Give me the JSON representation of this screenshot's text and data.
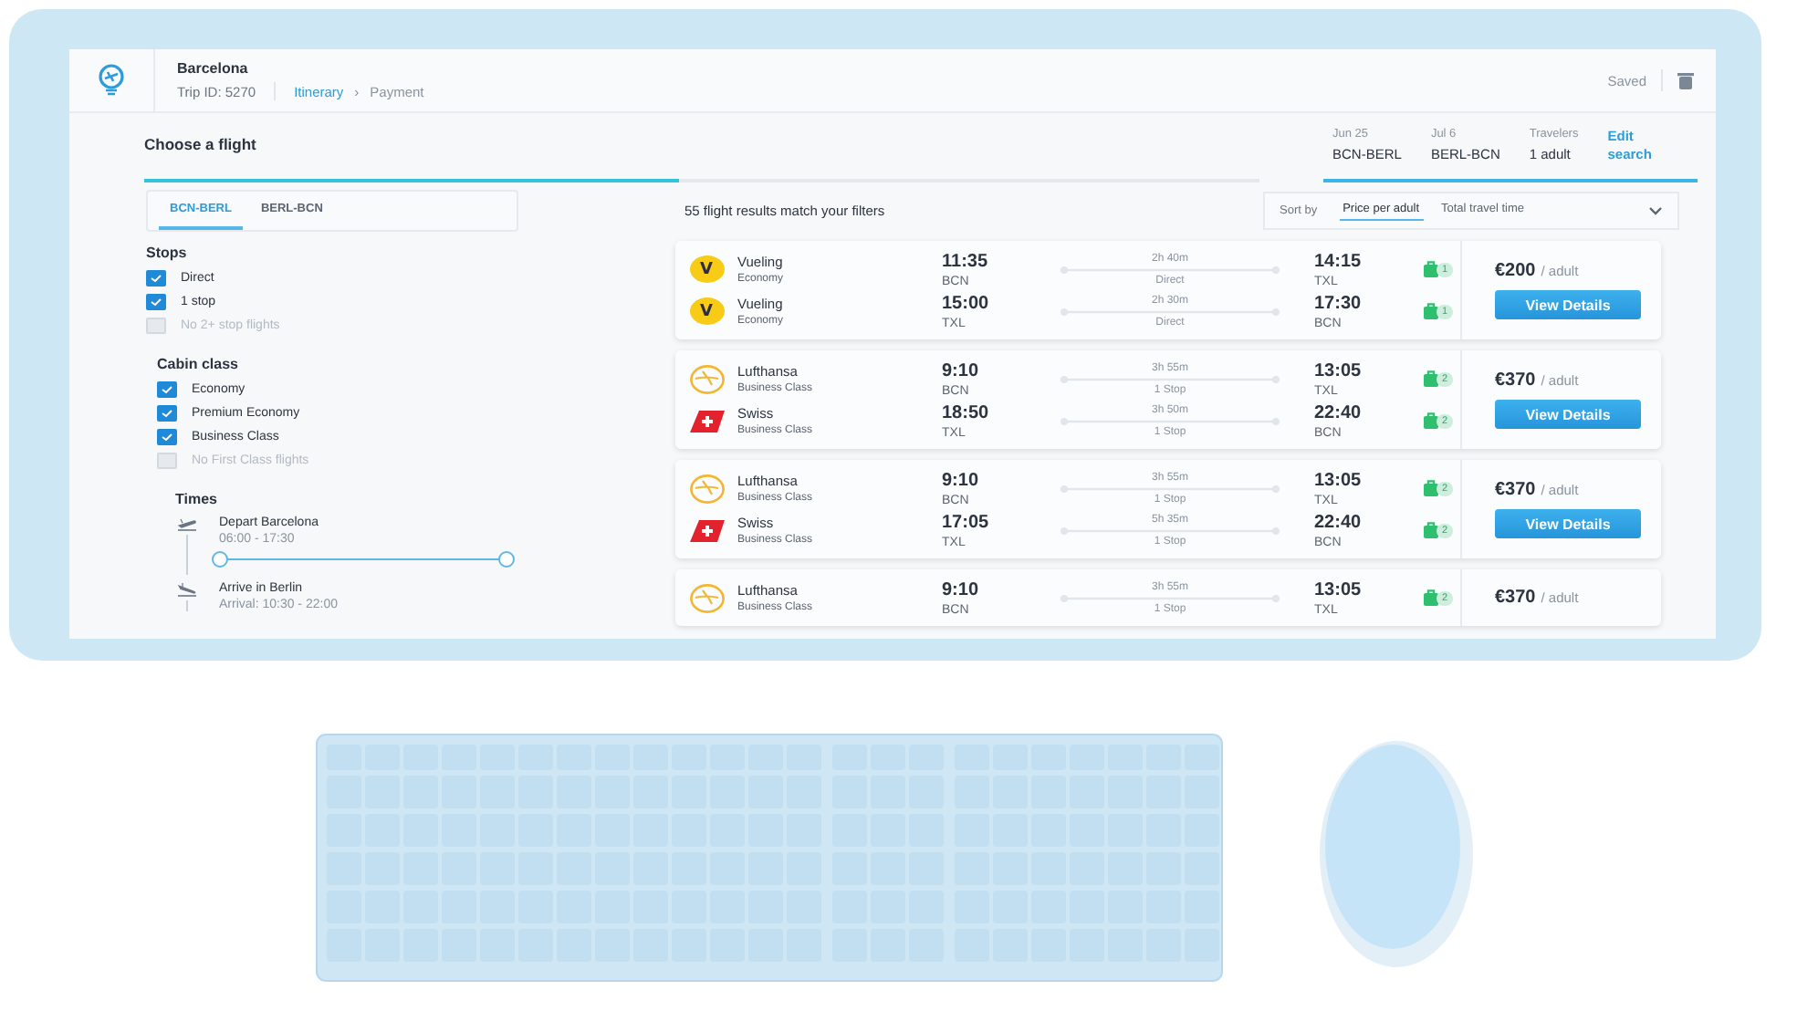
{
  "header": {
    "city": "Barcelona",
    "trip_id": "Trip ID: 5270",
    "breadcrumb": [
      {
        "label": "Itinerary",
        "selected": true
      },
      {
        "label": "Payment",
        "selected": false
      }
    ],
    "separator": "›",
    "saved": "Saved"
  },
  "page_title": "Choose a flight",
  "step_progress": {
    "level": 0.48
  },
  "trip_summary": [
    {
      "label": "Jun 25",
      "value": "BCN-BERL"
    },
    {
      "label": "Jul 6",
      "value": "BERL-BCN"
    },
    {
      "label": "Travelers",
      "value": "1 adult"
    }
  ],
  "edit_link": "Edit search",
  "route_tabs": [
    {
      "label": "BCN-BERL",
      "selected": true
    },
    {
      "label": "BERL-BCN",
      "selected": false
    }
  ],
  "results_count": "55 flight results match your filters",
  "sort": {
    "label": "Sort by",
    "options": [
      {
        "label": "Price per adult",
        "selected": true
      },
      {
        "label": "Total travel time",
        "selected": false
      }
    ]
  },
  "filters": [
    {
      "title": "Stops",
      "options": [
        {
          "label": "Direct",
          "checked": true,
          "disabled": false
        },
        {
          "label": "1 stop",
          "checked": true,
          "disabled": false
        },
        {
          "label": "No 2+ stop flights",
          "checked": false,
          "disabled": true
        }
      ]
    },
    {
      "title": "Cabin class",
      "options": [
        {
          "label": "Economy",
          "checked": true,
          "disabled": false
        },
        {
          "label": "Premium Economy",
          "checked": true,
          "disabled": false
        },
        {
          "label": "Business Class",
          "checked": true,
          "disabled": false
        },
        {
          "label": "No First Class flights",
          "checked": false,
          "disabled": true
        }
      ]
    }
  ],
  "times": {
    "title": "Times",
    "items": [
      {
        "kind": "depart",
        "label": "Depart Barcelona",
        "range": "06:00 - 17:30",
        "slider": {
          "level": 1
        }
      },
      {
        "kind": "arrive",
        "label": "Arrive in Berlin",
        "range": "Arrival: 10:30 - 22:00"
      }
    ]
  },
  "results": [
    {
      "legs": [
        {
          "kind": "vueling",
          "logo_text": "V",
          "airline": "Vueling",
          "cabin": "Economy",
          "depart_time": "11:35",
          "depart_airport": "BCN",
          "duration": "2h 40m",
          "stops": "Direct",
          "arrive_time": "14:15",
          "arrive_airport": "TXL",
          "bags": "1"
        },
        {
          "kind": "vueling",
          "logo_text": "V",
          "airline": "Vueling",
          "cabin": "Economy",
          "depart_time": "15:00",
          "depart_airport": "TXL",
          "duration": "2h 30m",
          "stops": "Direct",
          "arrive_time": "17:30",
          "arrive_airport": "BCN",
          "bags": "1"
        }
      ],
      "price": "€200",
      "price_unit": "/ adult",
      "button": "View Details"
    },
    {
      "legs": [
        {
          "kind": "lufthansa",
          "airline": "Lufthansa",
          "cabin": "Business Class",
          "depart_time": "9:10",
          "depart_airport": "BCN",
          "duration": "3h 55m",
          "stops": "1 Stop",
          "arrive_time": "13:05",
          "arrive_airport": "TXL",
          "bags": "2"
        },
        {
          "kind": "swiss",
          "airline": "Swiss",
          "cabin": "Business Class",
          "depart_time": "18:50",
          "depart_airport": "TXL",
          "duration": "3h 50m",
          "stops": "1 Stop",
          "arrive_time": "22:40",
          "arrive_airport": "BCN",
          "bags": "2"
        }
      ],
      "price": "€370",
      "price_unit": "/ adult",
      "button": "View Details"
    },
    {
      "legs": [
        {
          "kind": "lufthansa",
          "airline": "Lufthansa",
          "cabin": "Business Class",
          "depart_time": "9:10",
          "depart_airport": "BCN",
          "duration": "3h 55m",
          "stops": "1 Stop",
          "arrive_time": "13:05",
          "arrive_airport": "TXL",
          "bags": "2"
        },
        {
          "kind": "swiss",
          "airline": "Swiss",
          "cabin": "Business Class",
          "depart_time": "17:05",
          "depart_airport": "TXL",
          "duration": "5h 35m",
          "stops": "1 Stop",
          "arrive_time": "22:40",
          "arrive_airport": "BCN",
          "bags": "2"
        }
      ],
      "price": "€370",
      "price_unit": "/ adult",
      "button": "View Details"
    },
    {
      "legs": [
        {
          "kind": "lufthansa",
          "airline": "Lufthansa",
          "cabin": "Business Class",
          "depart_time": "9:10",
          "depart_airport": "BCN",
          "duration": "3h 55m",
          "stops": "1 Stop",
          "arrive_time": "13:05",
          "arrive_airport": "TXL",
          "bags": "2"
        }
      ],
      "price": "€370",
      "price_unit": "/ adult"
    }
  ]
}
